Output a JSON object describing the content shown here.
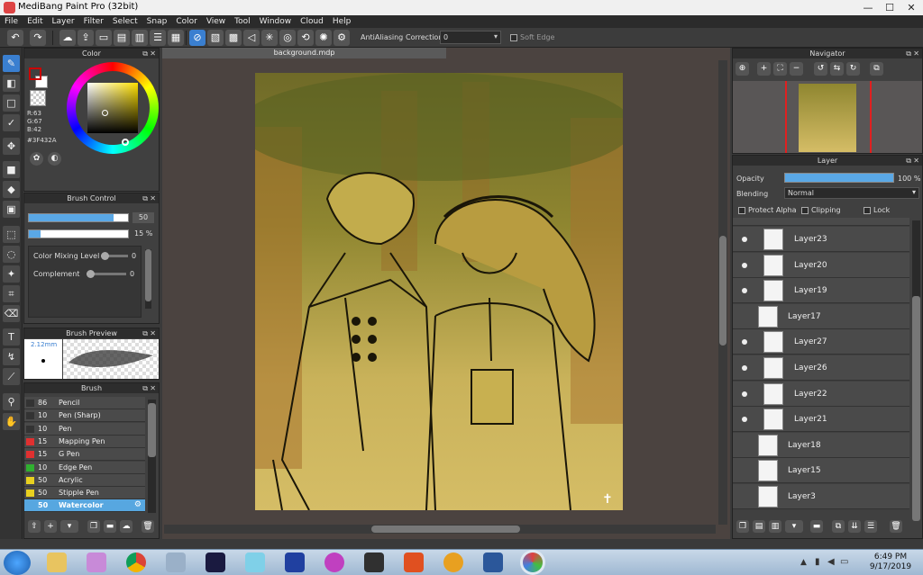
{
  "window": {
    "title": "MediBang Paint Pro (32bit)",
    "min": "—",
    "max": "☐",
    "close": "✕"
  },
  "menu": [
    "File",
    "Edit",
    "Layer",
    "Filter",
    "Select",
    "Snap",
    "Color",
    "View",
    "Tool",
    "Window",
    "Cloud",
    "Help"
  ],
  "toolbar": {
    "antialiasing_label": "AntiAliasing",
    "correction_label": "Correction",
    "correction_value": "0",
    "soft_edge_label": "Soft Edge"
  },
  "color_panel": {
    "title": "Color",
    "r": "R:63",
    "g": "G:67",
    "b": "B:42",
    "hex": "#3F432A",
    "fg_color": "#3F432A"
  },
  "brush_control": {
    "title": "Brush Control",
    "size_value": "50",
    "opacity_value": "15 %",
    "size_fill": 0.85,
    "opacity_fill": 0.12,
    "color_mixing_label": "Color Mixing Level",
    "color_mixing_value": "0",
    "complement_label": "Complement",
    "complement_value": "0"
  },
  "brush_preview": {
    "title": "Brush Preview",
    "size": "2.12mm"
  },
  "brush_panel": {
    "title": "Brush",
    "items": [
      {
        "size": "86",
        "name": "Pencil",
        "color": "#333333"
      },
      {
        "size": "10",
        "name": "Pen (Sharp)",
        "color": "#333333"
      },
      {
        "size": "10",
        "name": "Pen",
        "color": "#333333"
      },
      {
        "size": "15",
        "name": "Mapping Pen",
        "color": "#e03030"
      },
      {
        "size": "15",
        "name": "G Pen",
        "color": "#e03030"
      },
      {
        "size": "10",
        "name": "Edge Pen",
        "color": "#30b030"
      },
      {
        "size": "50",
        "name": "Acrylic",
        "color": "#e8d020"
      },
      {
        "size": "50",
        "name": "Stipple Pen",
        "color": "#e8d020"
      },
      {
        "size": "50",
        "name": "Watercolor",
        "color": "#57a7e0"
      }
    ]
  },
  "document": {
    "tab": "background.mdp"
  },
  "navigator": {
    "title": "Navigator"
  },
  "layer_panel": {
    "title": "Layer",
    "opacity_label": "Opacity",
    "opacity_value": "100 %",
    "opacity_fill": 1.0,
    "blending_label": "Blending",
    "blending_value": "Normal",
    "protect_alpha_label": "Protect Alpha",
    "clipping_label": "Clipping",
    "lock_label": "Lock",
    "layers": [
      {
        "name": "Layer23",
        "visible": true,
        "indent": true
      },
      {
        "name": "Layer20",
        "visible": true,
        "indent": true
      },
      {
        "name": "Layer19",
        "visible": true,
        "indent": true
      },
      {
        "name": "Layer17",
        "visible": false,
        "indent": false
      },
      {
        "name": "Layer27",
        "visible": true,
        "indent": true
      },
      {
        "name": "Layer26",
        "visible": true,
        "indent": true
      },
      {
        "name": "Layer22",
        "visible": true,
        "indent": true
      },
      {
        "name": "Layer21",
        "visible": true,
        "indent": true
      },
      {
        "name": "Layer18",
        "visible": false,
        "indent": false
      },
      {
        "name": "Layer15",
        "visible": false,
        "indent": false
      },
      {
        "name": "Layer3",
        "visible": false,
        "indent": false
      }
    ]
  },
  "taskbar": {
    "time": "6:49 PM",
    "date": "9/17/2019"
  }
}
